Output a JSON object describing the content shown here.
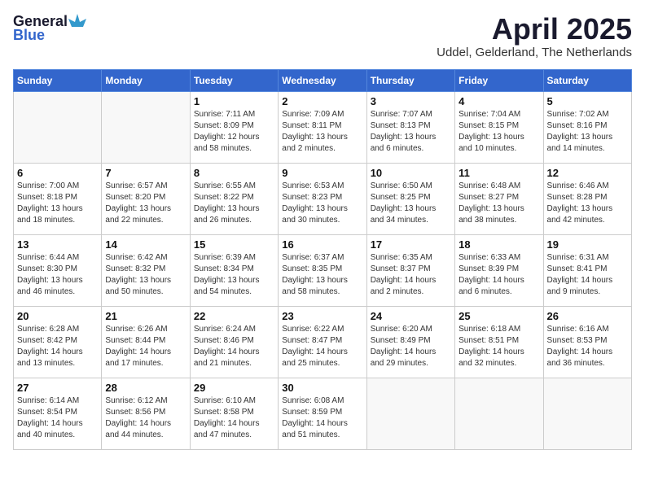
{
  "header": {
    "logo_general": "General",
    "logo_blue": "Blue",
    "title": "April 2025",
    "subtitle": "Uddel, Gelderland, The Netherlands"
  },
  "weekdays": [
    "Sunday",
    "Monday",
    "Tuesday",
    "Wednesday",
    "Thursday",
    "Friday",
    "Saturday"
  ],
  "weeks": [
    [
      {
        "day": "",
        "info": ""
      },
      {
        "day": "",
        "info": ""
      },
      {
        "day": "1",
        "info": "Sunrise: 7:11 AM\nSunset: 8:09 PM\nDaylight: 12 hours\nand 58 minutes."
      },
      {
        "day": "2",
        "info": "Sunrise: 7:09 AM\nSunset: 8:11 PM\nDaylight: 13 hours\nand 2 minutes."
      },
      {
        "day": "3",
        "info": "Sunrise: 7:07 AM\nSunset: 8:13 PM\nDaylight: 13 hours\nand 6 minutes."
      },
      {
        "day": "4",
        "info": "Sunrise: 7:04 AM\nSunset: 8:15 PM\nDaylight: 13 hours\nand 10 minutes."
      },
      {
        "day": "5",
        "info": "Sunrise: 7:02 AM\nSunset: 8:16 PM\nDaylight: 13 hours\nand 14 minutes."
      }
    ],
    [
      {
        "day": "6",
        "info": "Sunrise: 7:00 AM\nSunset: 8:18 PM\nDaylight: 13 hours\nand 18 minutes."
      },
      {
        "day": "7",
        "info": "Sunrise: 6:57 AM\nSunset: 8:20 PM\nDaylight: 13 hours\nand 22 minutes."
      },
      {
        "day": "8",
        "info": "Sunrise: 6:55 AM\nSunset: 8:22 PM\nDaylight: 13 hours\nand 26 minutes."
      },
      {
        "day": "9",
        "info": "Sunrise: 6:53 AM\nSunset: 8:23 PM\nDaylight: 13 hours\nand 30 minutes."
      },
      {
        "day": "10",
        "info": "Sunrise: 6:50 AM\nSunset: 8:25 PM\nDaylight: 13 hours\nand 34 minutes."
      },
      {
        "day": "11",
        "info": "Sunrise: 6:48 AM\nSunset: 8:27 PM\nDaylight: 13 hours\nand 38 minutes."
      },
      {
        "day": "12",
        "info": "Sunrise: 6:46 AM\nSunset: 8:28 PM\nDaylight: 13 hours\nand 42 minutes."
      }
    ],
    [
      {
        "day": "13",
        "info": "Sunrise: 6:44 AM\nSunset: 8:30 PM\nDaylight: 13 hours\nand 46 minutes."
      },
      {
        "day": "14",
        "info": "Sunrise: 6:42 AM\nSunset: 8:32 PM\nDaylight: 13 hours\nand 50 minutes."
      },
      {
        "day": "15",
        "info": "Sunrise: 6:39 AM\nSunset: 8:34 PM\nDaylight: 13 hours\nand 54 minutes."
      },
      {
        "day": "16",
        "info": "Sunrise: 6:37 AM\nSunset: 8:35 PM\nDaylight: 13 hours\nand 58 minutes."
      },
      {
        "day": "17",
        "info": "Sunrise: 6:35 AM\nSunset: 8:37 PM\nDaylight: 14 hours\nand 2 minutes."
      },
      {
        "day": "18",
        "info": "Sunrise: 6:33 AM\nSunset: 8:39 PM\nDaylight: 14 hours\nand 6 minutes."
      },
      {
        "day": "19",
        "info": "Sunrise: 6:31 AM\nSunset: 8:41 PM\nDaylight: 14 hours\nand 9 minutes."
      }
    ],
    [
      {
        "day": "20",
        "info": "Sunrise: 6:28 AM\nSunset: 8:42 PM\nDaylight: 14 hours\nand 13 minutes."
      },
      {
        "day": "21",
        "info": "Sunrise: 6:26 AM\nSunset: 8:44 PM\nDaylight: 14 hours\nand 17 minutes."
      },
      {
        "day": "22",
        "info": "Sunrise: 6:24 AM\nSunset: 8:46 PM\nDaylight: 14 hours\nand 21 minutes."
      },
      {
        "day": "23",
        "info": "Sunrise: 6:22 AM\nSunset: 8:47 PM\nDaylight: 14 hours\nand 25 minutes."
      },
      {
        "day": "24",
        "info": "Sunrise: 6:20 AM\nSunset: 8:49 PM\nDaylight: 14 hours\nand 29 minutes."
      },
      {
        "day": "25",
        "info": "Sunrise: 6:18 AM\nSunset: 8:51 PM\nDaylight: 14 hours\nand 32 minutes."
      },
      {
        "day": "26",
        "info": "Sunrise: 6:16 AM\nSunset: 8:53 PM\nDaylight: 14 hours\nand 36 minutes."
      }
    ],
    [
      {
        "day": "27",
        "info": "Sunrise: 6:14 AM\nSunset: 8:54 PM\nDaylight: 14 hours\nand 40 minutes."
      },
      {
        "day": "28",
        "info": "Sunrise: 6:12 AM\nSunset: 8:56 PM\nDaylight: 14 hours\nand 44 minutes."
      },
      {
        "day": "29",
        "info": "Sunrise: 6:10 AM\nSunset: 8:58 PM\nDaylight: 14 hours\nand 47 minutes."
      },
      {
        "day": "30",
        "info": "Sunrise: 6:08 AM\nSunset: 8:59 PM\nDaylight: 14 hours\nand 51 minutes."
      },
      {
        "day": "",
        "info": ""
      },
      {
        "day": "",
        "info": ""
      },
      {
        "day": "",
        "info": ""
      }
    ]
  ]
}
